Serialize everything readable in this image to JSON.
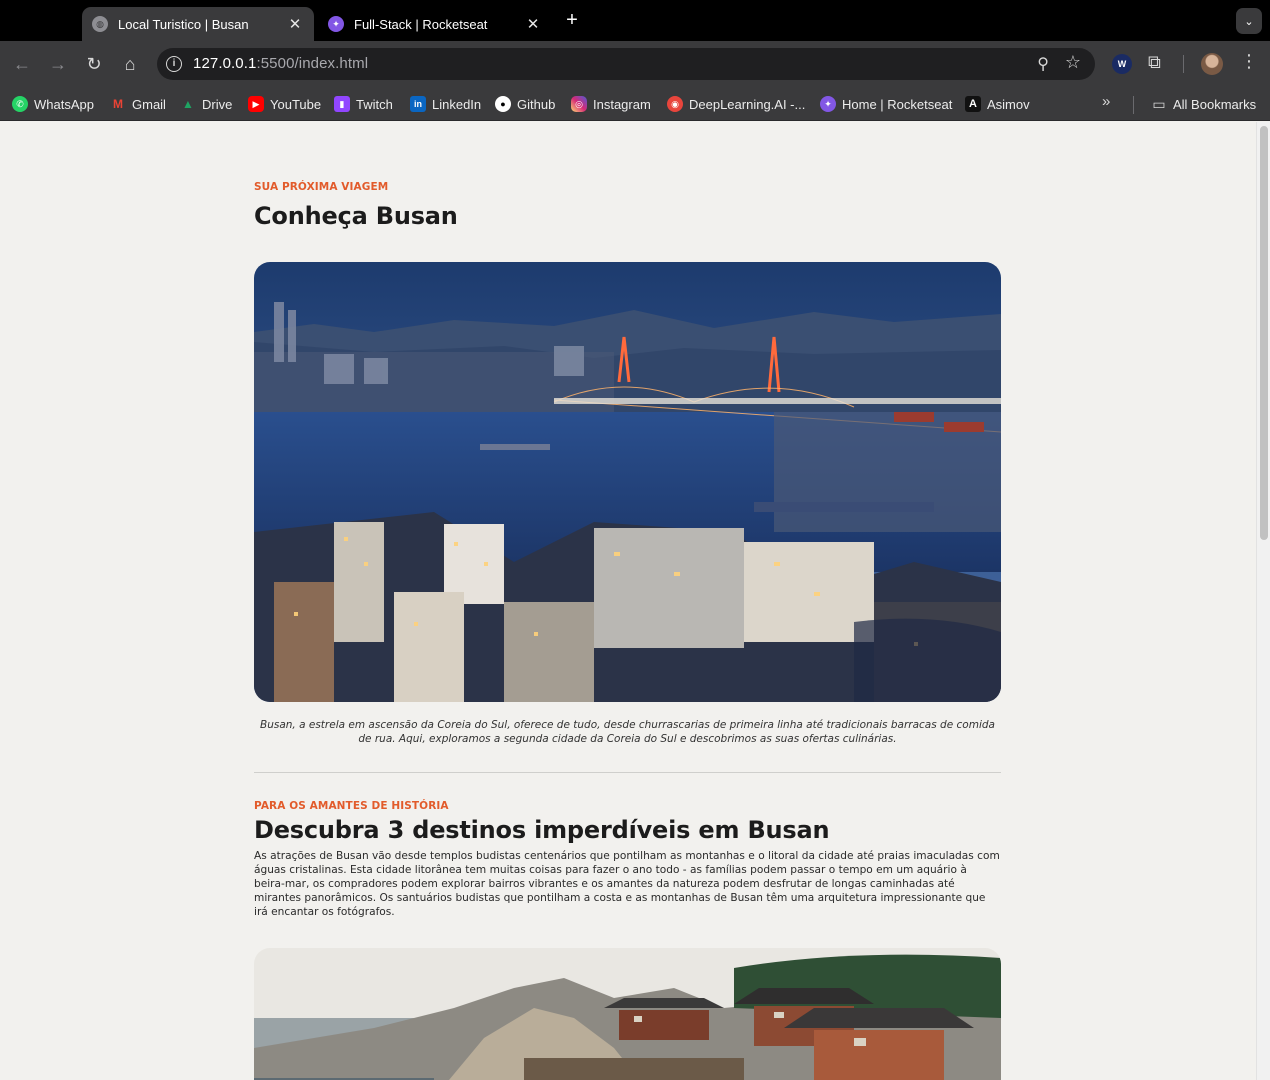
{
  "browser": {
    "tabs": [
      {
        "title": "Local Turistico | Busan",
        "active": true,
        "icon": "globe-icon"
      },
      {
        "title": "Full-Stack | Rocketseat",
        "active": false,
        "icon": "rocketseat-icon"
      }
    ],
    "url_host": "127.0.0.1",
    "url_rest": ":5500/index.html",
    "bookmarks": [
      {
        "label": "WhatsApp",
        "icon": "whatsapp-icon",
        "color": "#25d366"
      },
      {
        "label": "Gmail",
        "icon": "gmail-icon",
        "color": "#ea4335"
      },
      {
        "label": "Drive",
        "icon": "drive-icon",
        "color": "#1fa463"
      },
      {
        "label": "YouTube",
        "icon": "youtube-icon",
        "color": "#ff0000"
      },
      {
        "label": "Twitch",
        "icon": "twitch-icon",
        "color": "#9146ff"
      },
      {
        "label": "LinkedIn",
        "icon": "linkedin-icon",
        "color": "#0a66c2"
      },
      {
        "label": "Github",
        "icon": "github-icon",
        "color": "#ffffff"
      },
      {
        "label": "Instagram",
        "icon": "instagram-icon",
        "color": "#d62976"
      },
      {
        "label": "DeepLearning.AI -...",
        "icon": "deeplearning-icon",
        "color": "#e8453c"
      },
      {
        "label": "Home | Rocketseat",
        "icon": "rocketseat-icon",
        "color": "#8257e5"
      },
      {
        "label": "Asimov",
        "icon": "asimov-icon",
        "color": "#111111"
      }
    ],
    "all_bookmarks": "All Bookmarks"
  },
  "page": {
    "section1": {
      "eyebrow": "SUA PRÓXIMA VIAGEM",
      "title": "Conheça Busan",
      "caption": "Busan, a estrela em ascensão da Coreia do Sul, oferece de tudo, desde churrascarias de primeira linha até tradicionais barracas de comida de rua. Aqui, exploramos a segunda cidade da Coreia do Sul e descobrimos as suas ofertas culinárias."
    },
    "section2": {
      "eyebrow": "PARA OS AMANTES DE HISTÓRIA",
      "title": "Descubra 3 destinos imperdíveis em Busan",
      "body": "As atrações de Busan vão desde templos budistas centenários que pontilham as montanhas e o litoral da cidade até praias imaculadas com águas cristalinas. Esta cidade litorânea tem muitas coisas para fazer o ano todo - as famílias podem passar o tempo em um aquário à beira-mar, os compradores podem explorar bairros vibrantes e os amantes da natureza podem desfrutar de longas caminhadas até mirantes panorâmicos. Os santuários budistas que pontilham a costa e as montanhas de Busan têm uma arquitetura impressionante que irá encantar os fotógrafos."
    },
    "accent_color": "#e25b2b"
  }
}
